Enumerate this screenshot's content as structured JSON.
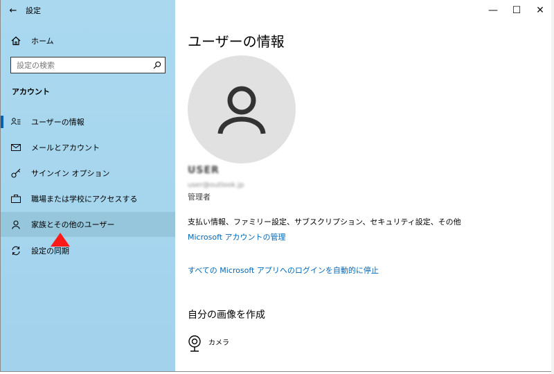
{
  "window": {
    "app_title": "設定"
  },
  "sidebar": {
    "home_label": "ホーム",
    "search_placeholder": "設定の検索",
    "section_title": "アカウント",
    "items": [
      {
        "label": "ユーザーの情報",
        "icon": "user-info-icon"
      },
      {
        "label": "メールとアカウント",
        "icon": "mail-icon"
      },
      {
        "label": "サインイン オプション",
        "icon": "key-icon"
      },
      {
        "label": "職場または学校にアクセスする",
        "icon": "briefcase-icon"
      },
      {
        "label": "家族とその他のユーザー",
        "icon": "person-icon"
      },
      {
        "label": "設定の同期",
        "icon": "sync-icon"
      }
    ],
    "selected_index": 4,
    "active_index": 0
  },
  "main": {
    "title": "ユーザーの情報",
    "user": {
      "name": "USER",
      "email": "user@outlook.jp",
      "role": "管理者"
    },
    "info_text": "支払い情報、ファミリー設定、サブスクリプション、セキュリティ設定、その他",
    "manage_link": "Microsoft アカウントの管理",
    "auto_login_link": "すべての Microsoft アプリへのログインを自動的に停止",
    "create_picture_title": "自分の画像を作成",
    "camera_label": "カメラ"
  },
  "colors": {
    "sidebar_bg": "#a9d8ef",
    "selected_bg": "#96c6dc",
    "accent": "#0063b1",
    "link": "#0067b8",
    "arrow": "#ff1a1a"
  }
}
